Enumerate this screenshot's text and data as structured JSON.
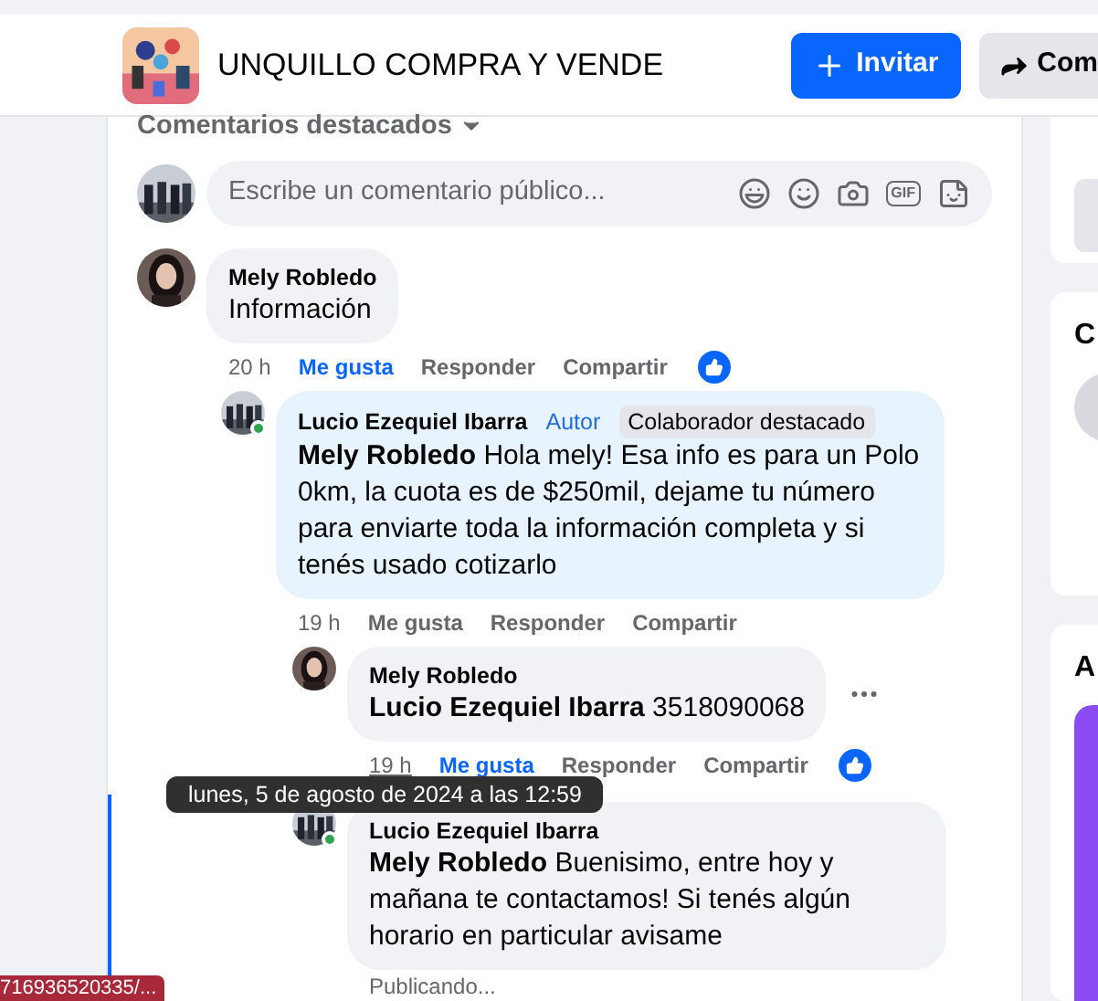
{
  "header": {
    "title": "UNQUILLO COMPRA Y VENDE",
    "invite": "Invitar",
    "share": "Com"
  },
  "sort_label": "Comentarios destacados",
  "composer": {
    "placeholder": "Escribe un comentario público...",
    "gif_label": "GIF"
  },
  "comments": [
    {
      "author": "Mely Robledo",
      "text": "Información",
      "online": false,
      "time": "20 h",
      "time_hovered": false,
      "like": "Me gusta",
      "reply": "Responder",
      "share": "Compartir",
      "liked": true,
      "show_menu": false,
      "children": [
        {
          "author": "Lucio Ezequiel Ibarra",
          "mention": "Mely Robledo",
          "text": "Hola mely! Esa info es para un Polo 0km, la cuota es de $250mil, dejame tu número para enviarte toda la información completa y si tenés usado cotizarlo",
          "badges": [
            {
              "label": "Autor",
              "kind": "role"
            },
            {
              "label": "Colaborador destacado",
              "kind": "tag"
            }
          ],
          "online": true,
          "time": "19 h",
          "time_hovered": false,
          "like": "Me gusta",
          "reply": "Responder",
          "share": "Compartir",
          "liked": false,
          "show_menu": false,
          "children": [
            {
              "author": "Mely Robledo",
              "mention": "Lucio Ezequiel Ibarra",
              "text": "3518090068",
              "online": false,
              "time": "19 h",
              "time_hovered": true,
              "like": "Me gusta",
              "reply": "Responder",
              "share": "Compartir",
              "liked": true,
              "show_menu": true
            },
            {
              "author": "Lucio Ezequiel Ibarra",
              "mention": "Mely Robledo",
              "text": "Buenisimo, entre hoy y mañana te contactamos! Si tenés algún horario en particular avisame",
              "online": true,
              "show_menu": false,
              "status": "Publicando..."
            }
          ]
        }
      ]
    }
  ],
  "tooltip": "lunes, 5 de agosto de 2024 a las 12:59",
  "right_panels": [
    {
      "kind": "button"
    },
    {
      "kind": "people",
      "heading": "C"
    },
    {
      "kind": "banner",
      "heading": "A"
    }
  ],
  "status_url": "716936520335/..."
}
